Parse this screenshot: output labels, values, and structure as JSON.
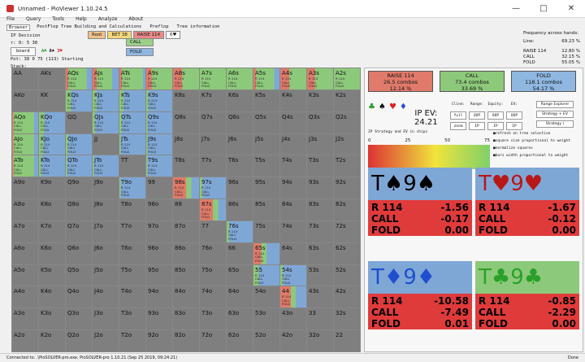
{
  "window": {
    "title": "Unnamed - PioViewer 1.10.24.5"
  },
  "menu": [
    "File",
    "Query",
    "Tools",
    "Help",
    "Analyze",
    "About"
  ],
  "tabs": [
    "Browser",
    "PostFlop Tree Building and Calculations",
    "Preflop",
    "Tree information"
  ],
  "position": {
    "label": "IP Decision",
    "range_line": "r: 0: 5 38",
    "board_button": "board",
    "pot_line": "Pot: 38 0 75 (113) Starting Stack:"
  },
  "board": [
    {
      "rank": "A",
      "suit": "♣",
      "color": "#2a9a2a"
    },
    {
      "rank": "8",
      "suit": "♠",
      "color": "#111"
    },
    {
      "rank": "3",
      "suit": "♥",
      "color": "#d22"
    }
  ],
  "actions": {
    "path": [
      {
        "label": "Root",
        "bg": "#f0c28a"
      },
      {
        "label": "BET 38",
        "bg": "#f5d77a"
      },
      {
        "label": "RAISE 114",
        "bg": "#e88a8a"
      },
      {
        "label": "6♥",
        "bg": "#ffffff"
      }
    ],
    "options": [
      {
        "label": "CALL",
        "bg": "#9ccf8a"
      },
      {
        "label": "FOLD",
        "bg": "#8fb7e0"
      }
    ]
  },
  "frequency": {
    "title": "Frequency across hands:",
    "rows": [
      {
        "k": "Line:",
        "v": "69.23 %"
      },
      {
        "k": "RAISE 114",
        "v": "12.80 %"
      },
      {
        "k": "CALL",
        "v": "32.15 %"
      },
      {
        "k": "FOLD",
        "v": "55.05 %"
      }
    ]
  },
  "hands": [
    [
      "AA",
      "AKs",
      "AQs",
      "AJs",
      "ATs",
      "A9s",
      "A8s",
      "A7s",
      "A6s",
      "A5s",
      "A4s",
      "A3s",
      "A2s"
    ],
    [
      "AKo",
      "KK",
      "KQs",
      "KJs",
      "KTs",
      "K9s",
      "K8s",
      "K7s",
      "K6s",
      "K5s",
      "K4s",
      "K3s",
      "K2s"
    ],
    [
      "AQo",
      "KQo",
      "QQ",
      "QJs",
      "QTs",
      "Q9s",
      "Q8s",
      "Q7s",
      "Q6s",
      "Q5s",
      "Q4s",
      "Q3s",
      "Q2s"
    ],
    [
      "AJo",
      "KJo",
      "QJo",
      "JJ",
      "JTs",
      "J9s",
      "J8s",
      "J7s",
      "J6s",
      "J5s",
      "J4s",
      "J3s",
      "J2s"
    ],
    [
      "ATo",
      "KTo",
      "QTo",
      "JTo",
      "TT",
      "T9s",
      "T8s",
      "T7s",
      "T6s",
      "T5s",
      "T4s",
      "T3s",
      "T2s"
    ],
    [
      "A9o",
      "K9o",
      "Q9o",
      "J9o",
      "T9o",
      "99",
      "98s",
      "97s",
      "96s",
      "95s",
      "94s",
      "93s",
      "92s"
    ],
    [
      "A8o",
      "K8o",
      "Q8o",
      "J8o",
      "T8o",
      "98o",
      "88",
      "87s",
      "86s",
      "85s",
      "84s",
      "83s",
      "82s"
    ],
    [
      "A7o",
      "K7o",
      "Q7o",
      "J7o",
      "T7o",
      "97o",
      "87o",
      "77",
      "76s",
      "75s",
      "74s",
      "73s",
      "72s"
    ],
    [
      "A6o",
      "K6o",
      "Q6o",
      "J6o",
      "T6o",
      "96o",
      "86o",
      "76o",
      "66",
      "65s",
      "64s",
      "63s",
      "62s"
    ],
    [
      "A5o",
      "K5o",
      "Q5o",
      "J5o",
      "T5o",
      "95o",
      "85o",
      "75o",
      "65o",
      "55",
      "54s",
      "53s",
      "52s"
    ],
    [
      "A4o",
      "K4o",
      "Q4o",
      "J4o",
      "T4o",
      "94o",
      "84o",
      "74o",
      "64o",
      "54o",
      "44",
      "43s",
      "42s"
    ],
    [
      "A3o",
      "K3o",
      "Q3o",
      "J3o",
      "T3o",
      "93o",
      "83o",
      "73o",
      "63o",
      "53o",
      "43o",
      "33",
      "32s"
    ],
    [
      "A2o",
      "K2o",
      "Q2o",
      "J2o",
      "T2o",
      "92o",
      "82o",
      "72o",
      "62o",
      "52o",
      "42o",
      "32o",
      "22"
    ]
  ],
  "hand_stats_text": "R 114\nCALL\nFOLD",
  "range_colors": {
    "raise": "#e07a6a",
    "call": "#8dc97a",
    "fold": "#7fa7d6",
    "empty": "#7f7f7f"
  },
  "range_fills": {
    "AQs": [
      0.1,
      0.7,
      0.2
    ],
    "AJs": [
      0.15,
      0.6,
      0.25
    ],
    "ATs": [
      0.1,
      0.8,
      0.1
    ],
    "A9s": [
      0.2,
      0.8,
      0
    ],
    "A8s": [
      0.35,
      0.65,
      0
    ],
    "A7s": [
      0,
      1,
      0
    ],
    "A6s": [
      0,
      1,
      0
    ],
    "A5s": [
      0.1,
      0.7,
      0.2
    ],
    "A4s": [
      0.35,
      0.65,
      0
    ],
    "A3s": [
      0.3,
      0.7,
      0
    ],
    "A2s": [
      0,
      1,
      0
    ],
    "KQs": [
      0,
      0.2,
      0.8
    ],
    "KJs": [
      0,
      0.15,
      0.85
    ],
    "KTs": [
      0,
      0.15,
      0.85
    ],
    "K9s": [
      0,
      0.1,
      0.9
    ],
    "AQo": [
      0.05,
      0.8,
      0.15
    ],
    "KQo": [
      0,
      0.2,
      0.8
    ],
    "QJs": [
      0,
      0.1,
      0.9
    ],
    "QTs": [
      0,
      0.1,
      0.9
    ],
    "Q9s": [
      0,
      0.05,
      0.95
    ],
    "AJo": [
      0.05,
      0.8,
      0.15
    ],
    "KJo": [
      0,
      0.15,
      0.85
    ],
    "QJo": [
      0,
      0.1,
      0.9
    ],
    "JTs": [
      0,
      0.05,
      0.95
    ],
    "J9s": [
      0,
      0.05,
      0.95
    ],
    "ATo": [
      0.05,
      0.8,
      0.15
    ],
    "KTo": [
      0,
      0.1,
      0.9
    ],
    "QTo": [
      0,
      0.05,
      0.95
    ],
    "JTo": [
      0,
      0.05,
      0.95
    ],
    "T9s": [
      0,
      0.05,
      0.95
    ],
    "98s": [
      0.5,
      0.2,
      0.3
    ],
    "87s": [
      0.5,
      0.2,
      0.3
    ],
    "97s": [
      0,
      0.1,
      0.9
    ],
    "T9o": [
      0,
      0.05,
      0.95
    ],
    "76s": [
      0,
      0.1,
      0.9
    ],
    "65s": [
      0.3,
      0.2,
      0.5
    ],
    "55": [
      0,
      0.2,
      0.8
    ],
    "54s": [
      0,
      0.1,
      0.9
    ],
    "44": [
      0.4,
      0.2,
      0.4
    ]
  },
  "sidebar": {
    "boxes": [
      {
        "lines": [
          "RAISE 114",
          "26.5 combos",
          "12.14 %"
        ],
        "bg": "#e07a6a"
      },
      {
        "lines": [
          "CALL",
          "73.4 combos",
          "33.69 %"
        ],
        "bg": "#8dc97a"
      },
      {
        "lines": [
          "FOLD",
          "118.1 combos",
          "54.17 %"
        ],
        "bg": "#8fb7e0"
      }
    ],
    "suit_icons": [
      "♣",
      "♠",
      "♥",
      "♦"
    ],
    "ev_label": "IP EV:",
    "ev_value": "24.21",
    "controls": [
      "Cline:",
      "Range:",
      "Equity:",
      "EV:",
      "full",
      "OOP",
      "OOP",
      "OOP",
      "zoom",
      "IP",
      "IP",
      "IP"
    ],
    "right_buttons": [
      "Range Explorer",
      "Strategy + EV",
      "Strategy   ("
    ],
    "ev_chips_label": "IP Strategy and EV in chips",
    "checks": [
      "refresh on tree selection",
      "square size proportional to weight",
      "normalize squares",
      "bars width proportional to weight"
    ],
    "scale": [
      "0",
      "25",
      "50",
      "75"
    ]
  },
  "combos": [
    {
      "card": "T♠9♠",
      "color": "#000",
      "bg": "#7fa7d6",
      "vals": [
        [
          "R 114",
          "-1.56"
        ],
        [
          "CALL",
          "-0.17"
        ],
        [
          "FOLD",
          "0.00"
        ]
      ]
    },
    {
      "card": "T♥9♥",
      "color": "#b81818",
      "bg": "#7fa7d6",
      "vals": [
        [
          "R 114",
          "-1.67"
        ],
        [
          "CALL",
          "-0.12"
        ],
        [
          "FOLD",
          "0.00"
        ]
      ]
    },
    {
      "card": "T♦9♦",
      "color": "#1f4fcf",
      "bg": "#7fa7d6",
      "vals": [
        [
          "R 114",
          "-10.58"
        ],
        [
          "CALL",
          "-7.49"
        ],
        [
          "FOLD",
          "0.01"
        ]
      ]
    },
    {
      "card": "T♣9♣",
      "color": "#2aa02a",
      "bg": "#8dc97a",
      "vals": [
        [
          "R 114",
          "-0.85"
        ],
        [
          "CALL",
          "-2.29"
        ],
        [
          "FOLD",
          "0.00"
        ]
      ]
    }
  ],
  "status": {
    "text": "Connected to: .\\PioSOLVER-pro.exe, PioSOLVER-pro 1.10.21 (Sep 25 2019, 09:24:21)",
    "done": "Done"
  }
}
